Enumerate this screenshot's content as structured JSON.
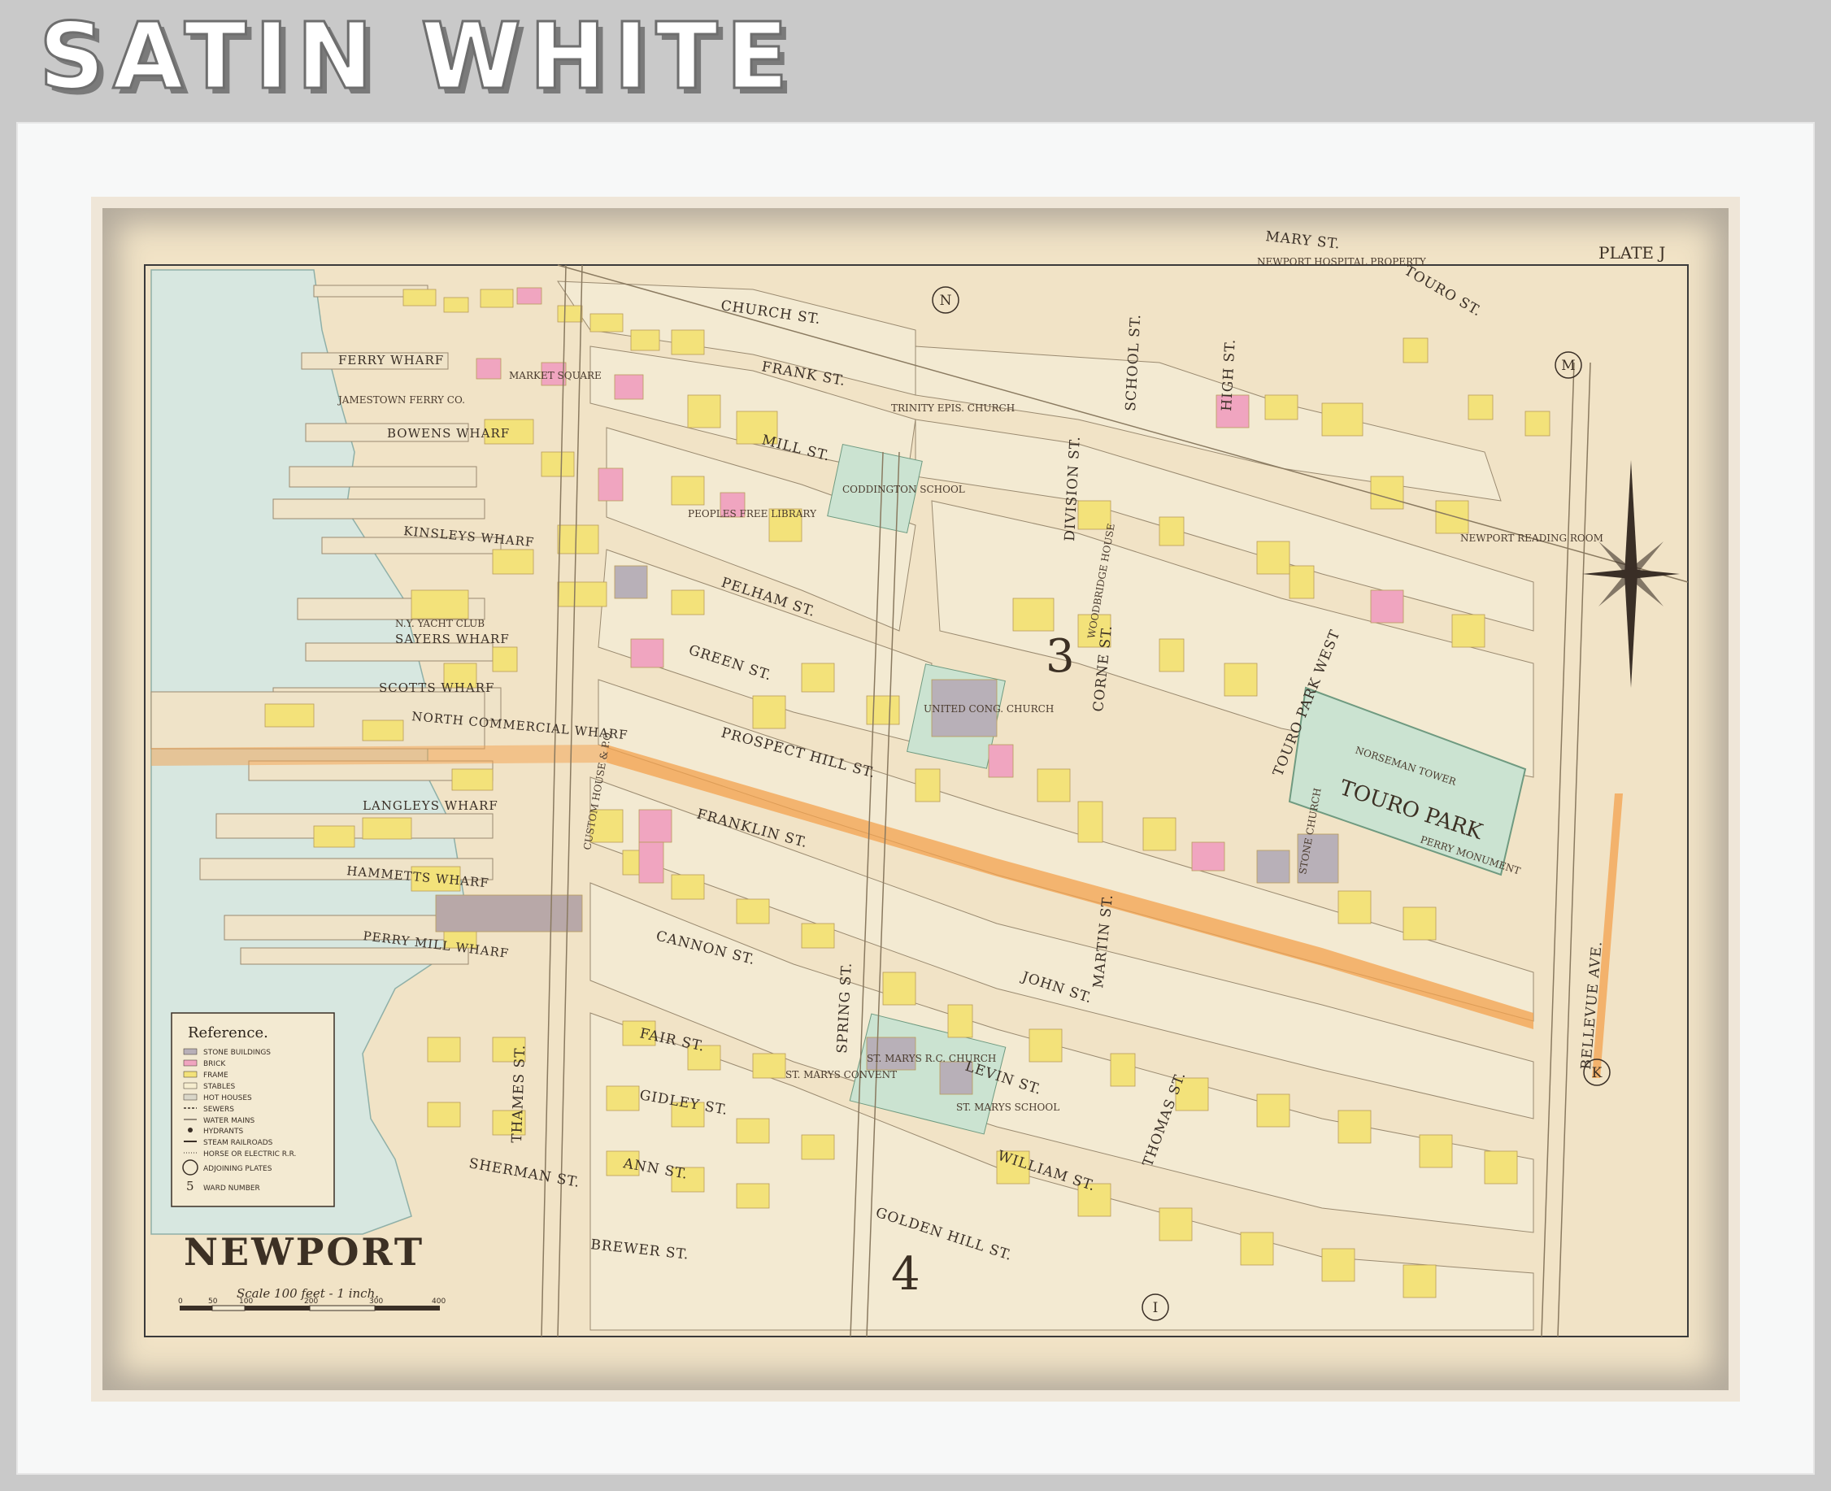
{
  "banner": {
    "title": "SATIN WHITE"
  },
  "map": {
    "plate": "PLATE J",
    "city": "NEWPORT",
    "scale": "Scale 100 feet - 1 inch.",
    "scale_ticks": [
      "0",
      "50",
      "100",
      "200",
      "300",
      "400"
    ],
    "ward_numbers": [
      "3",
      "4"
    ],
    "adjoining_plates": [
      "N",
      "M",
      "K",
      "I"
    ],
    "streets": [
      "CHURCH ST.",
      "FRANK ST.",
      "MILL ST.",
      "PELHAM ST.",
      "GREEN ST.",
      "PROSPECT HILL ST.",
      "FRANKLIN ST.",
      "CANNON ST.",
      "FAIR ST.",
      "GIDLEY ST.",
      "ANN ST.",
      "SHERMAN ST.",
      "BREWER ST.",
      "JOHN ST.",
      "LEVIN ST.",
      "WILLIAM ST.",
      "GOLDEN HILL ST.",
      "THAMES ST.",
      "SPRING ST.",
      "DIVISION ST.",
      "SCHOOL ST.",
      "HIGH ST.",
      "MARY ST.",
      "TOURO ST.",
      "CORNE ST.",
      "MARTIN ST.",
      "THOMAS ST.",
      "BELLEVUE AVE.",
      "TOURO PARK WEST"
    ],
    "wharves": [
      "FERRY WHARF",
      "BOWENS WHARF",
      "KINSLEYS WHARF",
      "SAYERS WHARF",
      "SCOTTS WHARF",
      "NORTH COMMERCIAL WHARF",
      "LANGLEYS WHARF",
      "HAMMETTS WHARF",
      "PERRY MILL WHARF"
    ],
    "landmarks": [
      "TRINITY EPIS. CHURCH",
      "CODDINGTON SCHOOL",
      "PEOPLES FREE LIBRARY",
      "UNITED CONG. CHURCH",
      "TOURO PARK",
      "NORSEMAN TOWER",
      "PERRY MONUMENT",
      "NEWPORT READING ROOM",
      "NEWPORT HOSPITAL PROPERTY",
      "ST. MARYS R.C. CHURCH",
      "ST. MARYS SCHOOL",
      "ST. MARYS CONVENT",
      "CUSTOM HOUSE & P.O.",
      "MARKET SQUARE",
      "JAMESTOWN FERRY CO.",
      "N.Y. YACHT CLUB",
      "STONE CHURCH",
      "WOODBRIDGE HOUSE"
    ],
    "legend": {
      "title": "Reference.",
      "items": [
        {
          "label": "STONE BUILDINGS",
          "color": "#b8b0b8"
        },
        {
          "label": "BRICK",
          "color": "#f0a5c0"
        },
        {
          "label": "FRAME",
          "color": "#f3e27a"
        },
        {
          "label": "STABLES",
          "color": "#f6edcf"
        },
        {
          "label": "HOT HOUSES",
          "color": "#dad7c9"
        },
        {
          "label": "SEWERS",
          "color": "#7a6a5a"
        },
        {
          "label": "WATER MAINS",
          "color": "#7a6a5a"
        },
        {
          "label": "HYDRANTS",
          "color": "#7a6a5a"
        },
        {
          "label": "STEAM RAILROADS",
          "color": "#7a6a5a"
        },
        {
          "label": "HORSE OR ELECTRIC R.R.",
          "color": "#7a6a5a"
        },
        {
          "label": "ADJOINING PLATES",
          "color": "#3a2f26"
        },
        {
          "label": "WARD NUMBER",
          "color": "#3a2f26"
        }
      ]
    },
    "colors": {
      "water": "#d7e7e0",
      "frame": "#f3e27a",
      "brick": "#f0a5c0",
      "stone": "#b8b0b8",
      "park": "#cbe3d1",
      "paper": "#f1e3c6",
      "highlight": "#f3a14d"
    }
  }
}
